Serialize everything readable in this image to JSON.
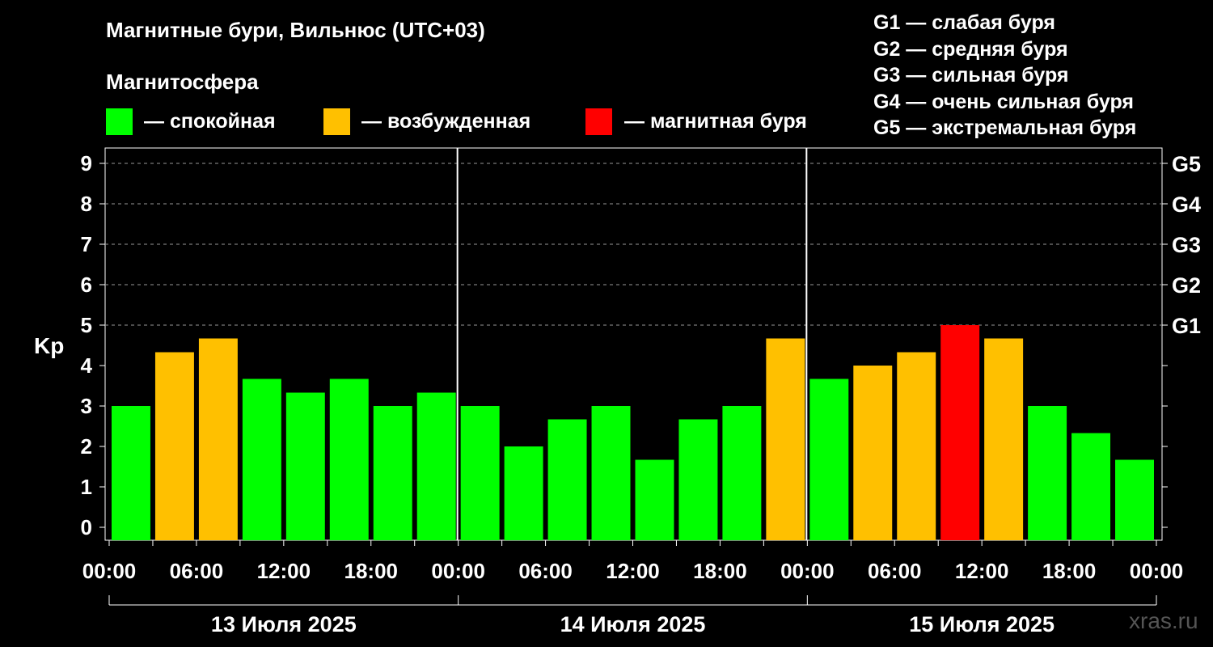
{
  "title": "Магнитные бури, Вильнюс (UTC+03)",
  "subtitle": "Магнитосфера",
  "legend": [
    {
      "label": "— спокойная",
      "color": "#00ff00"
    },
    {
      "label": "— возбужденная",
      "color": "#ffc000"
    },
    {
      "label": "— магнитная буря",
      "color": "#ff0000"
    }
  ],
  "storm_levels": [
    "G1 — слабая буря",
    "G2 — средняя буря",
    "G3 — сильная буря",
    "G4 — очень сильная буря",
    "G5 — экстремальная буря"
  ],
  "watermark": "xras.ru",
  "chart_data": {
    "type": "bar",
    "ylabel": "Kp",
    "ylim": [
      0,
      9
    ],
    "yticks": [
      "0",
      "1",
      "2",
      "3",
      "4",
      "5",
      "6",
      "7",
      "8",
      "9"
    ],
    "right_ticks": [
      {
        "value": 5,
        "label": "G1"
      },
      {
        "value": 6,
        "label": "G2"
      },
      {
        "value": 7,
        "label": "G3"
      },
      {
        "value": 8,
        "label": "G4"
      },
      {
        "value": 9,
        "label": "G5"
      }
    ],
    "grid": "horizontal dashed lines at 5–9",
    "x_tick_labels": [
      "00:00",
      "06:00",
      "12:00",
      "18:00",
      "00:00",
      "06:00",
      "12:00",
      "18:00",
      "00:00",
      "06:00",
      "12:00",
      "18:00",
      "00:00"
    ],
    "days": [
      "13 Июля 2025",
      "14 Июля 2025",
      "15 Июля 2025"
    ],
    "values": [
      3.0,
      4.33,
      4.67,
      3.67,
      3.33,
      3.67,
      3.0,
      3.33,
      3.0,
      2.0,
      2.67,
      3.0,
      1.67,
      2.67,
      3.0,
      4.67,
      3.67,
      4.0,
      4.33,
      5.0,
      4.67,
      3.0,
      2.33,
      1.67
    ],
    "colors": {
      "quiet": "#00ff00",
      "active": "#ffc000",
      "storm": "#ff0000"
    }
  }
}
